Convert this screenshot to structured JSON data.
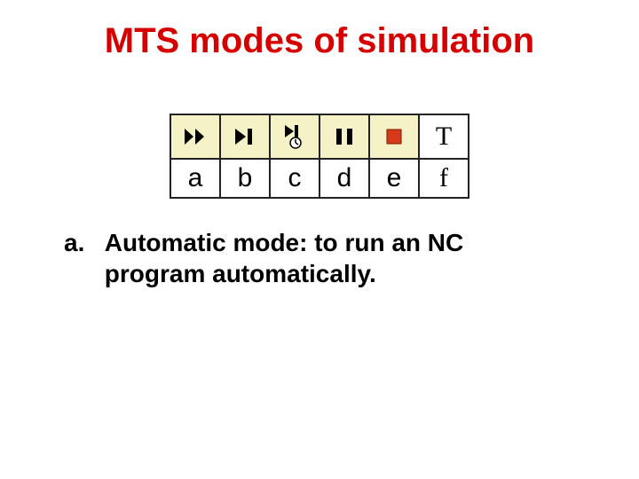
{
  "title": "MTS modes of simulation",
  "toolbar": {
    "icons": [
      {
        "name": "fast-forward-icon",
        "label": "a",
        "label_serif": false
      },
      {
        "name": "skip-to-end-icon",
        "label": "b",
        "label_serif": false
      },
      {
        "name": "frame-advance-icon",
        "label": "c",
        "label_serif": false
      },
      {
        "name": "pause-icon",
        "label": "d",
        "label_serif": false
      },
      {
        "name": "stop-icon",
        "label": "e",
        "label_serif": false
      },
      {
        "name": "t-mode-icon",
        "label": "f",
        "label_serif": true,
        "glyph": "T"
      }
    ]
  },
  "description": {
    "marker": "a.",
    "text": "Automatic mode: to run an NC program automatically."
  }
}
